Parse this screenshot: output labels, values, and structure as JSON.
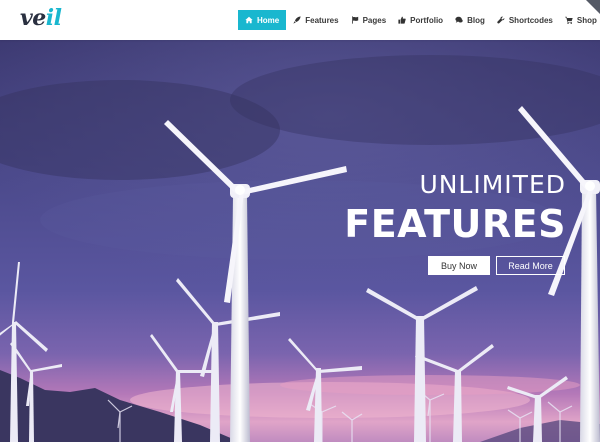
{
  "logo": {
    "text_main": "ve",
    "text_accent": "il"
  },
  "nav": {
    "items": [
      {
        "label": "Home",
        "icon": "home-icon",
        "active": true
      },
      {
        "label": "Features",
        "icon": "rocket-icon"
      },
      {
        "label": "Pages",
        "icon": "flag-icon"
      },
      {
        "label": "Portfolio",
        "icon": "thumbs-up-icon"
      },
      {
        "label": "Blog",
        "icon": "comments-icon"
      },
      {
        "label": "Shortcodes",
        "icon": "wrench-icon"
      },
      {
        "label": "Shop",
        "icon": "cart-icon"
      }
    ]
  },
  "hero": {
    "title_line1": "UNLIMITED",
    "title_line2": "FEATURES",
    "buy_label": "Buy Now",
    "more_label": "Read More"
  },
  "colors": {
    "accent": "#19b7cf",
    "sky_top": "#3f3c73",
    "sky_sunset": "#c980b8"
  }
}
